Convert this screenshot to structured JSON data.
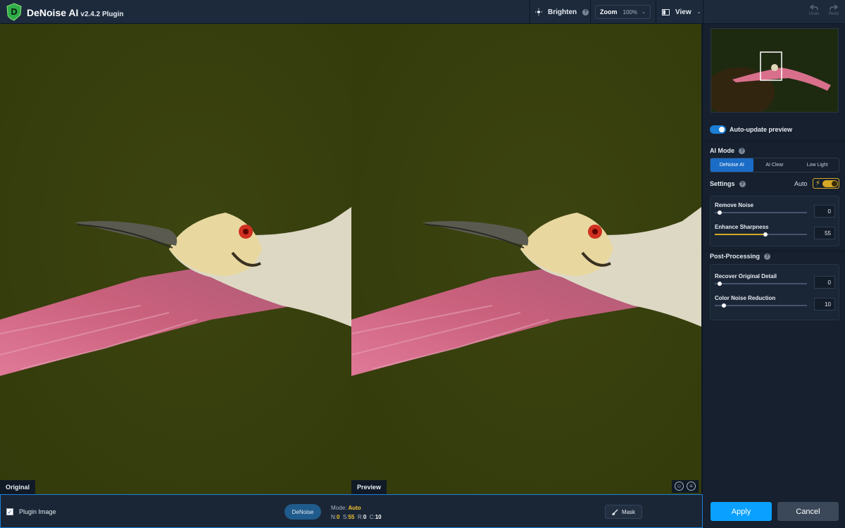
{
  "header": {
    "app_name": "DeNoise AI",
    "version": "v2.4.2 Plugin",
    "brighten_label": "Brighten",
    "help_glyph": "?",
    "zoom_label": "Zoom",
    "zoom_value": "100%",
    "view_label": "View",
    "undo_label": "Undo",
    "redo_label": "Redo",
    "icons": [
      "logo-icon",
      "sun-icon",
      "help-icon",
      "chevron-down-icon",
      "split-view-icon",
      "undo-icon",
      "redo-icon"
    ]
  },
  "panes": {
    "original_label": "Original",
    "preview_label": "Preview"
  },
  "sidebar": {
    "auto_update_label": "Auto-update preview",
    "ai_mode": {
      "label": "AI Mode",
      "options": [
        "DeNoise AI",
        "AI Clear",
        "Low Light"
      ],
      "selected": "DeNoise AI"
    },
    "settings": {
      "label": "Settings",
      "auto_label": "Auto",
      "sliders": [
        {
          "label": "Remove Noise",
          "value": "0",
          "level": 0
        },
        {
          "label": "Enhance Sharpness",
          "value": "55",
          "level": 55
        }
      ]
    },
    "post_processing": {
      "label": "Post-Processing",
      "sliders": [
        {
          "label": "Recover Original Detail",
          "value": "0",
          "level": 0
        },
        {
          "label": "Color Noise Reduction",
          "value": "10",
          "level": 10
        }
      ]
    },
    "apply_label": "Apply",
    "cancel_label": "Cancel"
  },
  "footer": {
    "plugin_image_label": "Plugin Image",
    "checkbox_glyph": "✓",
    "denoise_label": "DeNoise",
    "mode_label": "Mode:",
    "mode_value": "Auto",
    "n_label": "N:",
    "n_value": "0",
    "s_label": "S:",
    "s_value": "55",
    "r_label": "R:",
    "r_value": "0",
    "c_label": "C:",
    "c_value": "10",
    "mask_label": "Mask"
  },
  "colors": {
    "accent": "#0aa0ff",
    "toggle_blue": "#1b7fd6",
    "auto_yellow": "#d6a825",
    "background": "#16202e"
  }
}
